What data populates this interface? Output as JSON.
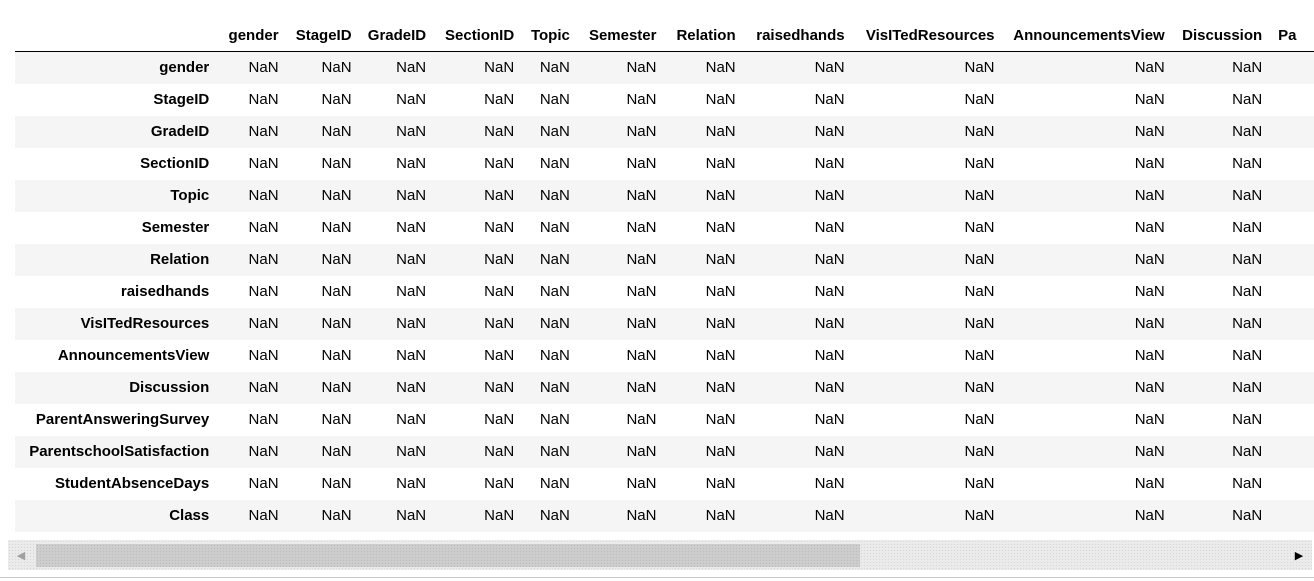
{
  "table": {
    "index_header": "",
    "columns": [
      "gender",
      "StageID",
      "GradeID",
      "SectionID",
      "Topic",
      "Semester",
      "Relation",
      "raisedhands",
      "VisITedResources",
      "AnnouncementsView",
      "Discussion",
      "Pa"
    ],
    "rows": [
      {
        "label": "gender",
        "cells": [
          "NaN",
          "NaN",
          "NaN",
          "NaN",
          "NaN",
          "NaN",
          "NaN",
          "NaN",
          "NaN",
          "NaN",
          "NaN"
        ]
      },
      {
        "label": "StageID",
        "cells": [
          "NaN",
          "NaN",
          "NaN",
          "NaN",
          "NaN",
          "NaN",
          "NaN",
          "NaN",
          "NaN",
          "NaN",
          "NaN"
        ]
      },
      {
        "label": "GradeID",
        "cells": [
          "NaN",
          "NaN",
          "NaN",
          "NaN",
          "NaN",
          "NaN",
          "NaN",
          "NaN",
          "NaN",
          "NaN",
          "NaN"
        ]
      },
      {
        "label": "SectionID",
        "cells": [
          "NaN",
          "NaN",
          "NaN",
          "NaN",
          "NaN",
          "NaN",
          "NaN",
          "NaN",
          "NaN",
          "NaN",
          "NaN"
        ]
      },
      {
        "label": "Topic",
        "cells": [
          "NaN",
          "NaN",
          "NaN",
          "NaN",
          "NaN",
          "NaN",
          "NaN",
          "NaN",
          "NaN",
          "NaN",
          "NaN"
        ]
      },
      {
        "label": "Semester",
        "cells": [
          "NaN",
          "NaN",
          "NaN",
          "NaN",
          "NaN",
          "NaN",
          "NaN",
          "NaN",
          "NaN",
          "NaN",
          "NaN"
        ]
      },
      {
        "label": "Relation",
        "cells": [
          "NaN",
          "NaN",
          "NaN",
          "NaN",
          "NaN",
          "NaN",
          "NaN",
          "NaN",
          "NaN",
          "NaN",
          "NaN"
        ]
      },
      {
        "label": "raisedhands",
        "cells": [
          "NaN",
          "NaN",
          "NaN",
          "NaN",
          "NaN",
          "NaN",
          "NaN",
          "NaN",
          "NaN",
          "NaN",
          "NaN"
        ]
      },
      {
        "label": "VisITedResources",
        "cells": [
          "NaN",
          "NaN",
          "NaN",
          "NaN",
          "NaN",
          "NaN",
          "NaN",
          "NaN",
          "NaN",
          "NaN",
          "NaN"
        ]
      },
      {
        "label": "AnnouncementsView",
        "cells": [
          "NaN",
          "NaN",
          "NaN",
          "NaN",
          "NaN",
          "NaN",
          "NaN",
          "NaN",
          "NaN",
          "NaN",
          "NaN"
        ]
      },
      {
        "label": "Discussion",
        "cells": [
          "NaN",
          "NaN",
          "NaN",
          "NaN",
          "NaN",
          "NaN",
          "NaN",
          "NaN",
          "NaN",
          "NaN",
          "NaN"
        ]
      },
      {
        "label": "ParentAnsweringSurvey",
        "cells": [
          "NaN",
          "NaN",
          "NaN",
          "NaN",
          "NaN",
          "NaN",
          "NaN",
          "NaN",
          "NaN",
          "NaN",
          "NaN"
        ]
      },
      {
        "label": "ParentschoolSatisfaction",
        "cells": [
          "NaN",
          "NaN",
          "NaN",
          "NaN",
          "NaN",
          "NaN",
          "NaN",
          "NaN",
          "NaN",
          "NaN",
          "NaN"
        ]
      },
      {
        "label": "StudentAbsenceDays",
        "cells": [
          "NaN",
          "NaN",
          "NaN",
          "NaN",
          "NaN",
          "NaN",
          "NaN",
          "NaN",
          "NaN",
          "NaN",
          "NaN"
        ]
      },
      {
        "label": "Class",
        "cells": [
          "NaN",
          "NaN",
          "NaN",
          "NaN",
          "NaN",
          "NaN",
          "NaN",
          "NaN",
          "NaN",
          "NaN",
          "NaN"
        ]
      }
    ]
  },
  "scrollbar": {
    "left_arrow_icon": "chevron-left-icon",
    "right_arrow_icon": "chevron-right-icon",
    "left_arrow_glyph": "◀",
    "right_arrow_glyph": "▶",
    "thumb_fraction": 0.66
  },
  "colors": {
    "row_stripe": "#f5f5f5",
    "scroll_track": "#ebebeb",
    "scroll_thumb": "#cdcdcd"
  }
}
